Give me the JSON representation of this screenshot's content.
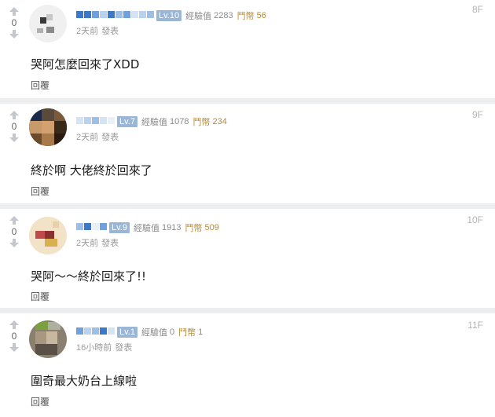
{
  "comments": [
    {
      "floor": "8F",
      "score": "0",
      "level": "Lv.10",
      "exp_label": "經驗值",
      "exp": "2283",
      "coin_label": "鬥幣",
      "coins": "56",
      "time": "2天前",
      "post_label": "發表",
      "text": "哭阿怎麼回來了XDD",
      "reply": "回覆"
    },
    {
      "floor": "9F",
      "score": "0",
      "level": "Lv.7",
      "exp_label": "經驗值",
      "exp": "1078",
      "coin_label": "鬥幣",
      "coins": "234",
      "time": "2天前",
      "post_label": "發表",
      "text": "終於啊 大佬終於回來了",
      "reply": "回覆"
    },
    {
      "floor": "10F",
      "score": "0",
      "level": "Lv.9",
      "exp_label": "經驗值",
      "exp": "1913",
      "coin_label": "鬥幣",
      "coins": "509",
      "time": "2天前",
      "post_label": "發表",
      "text": "哭阿～～終於回來了!!",
      "reply": "回覆"
    },
    {
      "floor": "11F",
      "score": "0",
      "level": "Lv.1",
      "exp_label": "經驗值",
      "exp": "0",
      "coin_label": "鬥幣",
      "coins": "1",
      "time": "16小時前",
      "post_label": "發表",
      "text": "圍奇最大奶台上線啦",
      "reply": "回覆"
    }
  ],
  "colors": {
    "level_badge": "#9ab6d6",
    "coin_text": "#b58a30",
    "divider": "#eceef0",
    "vote_arrow": "#c4c8cc"
  }
}
